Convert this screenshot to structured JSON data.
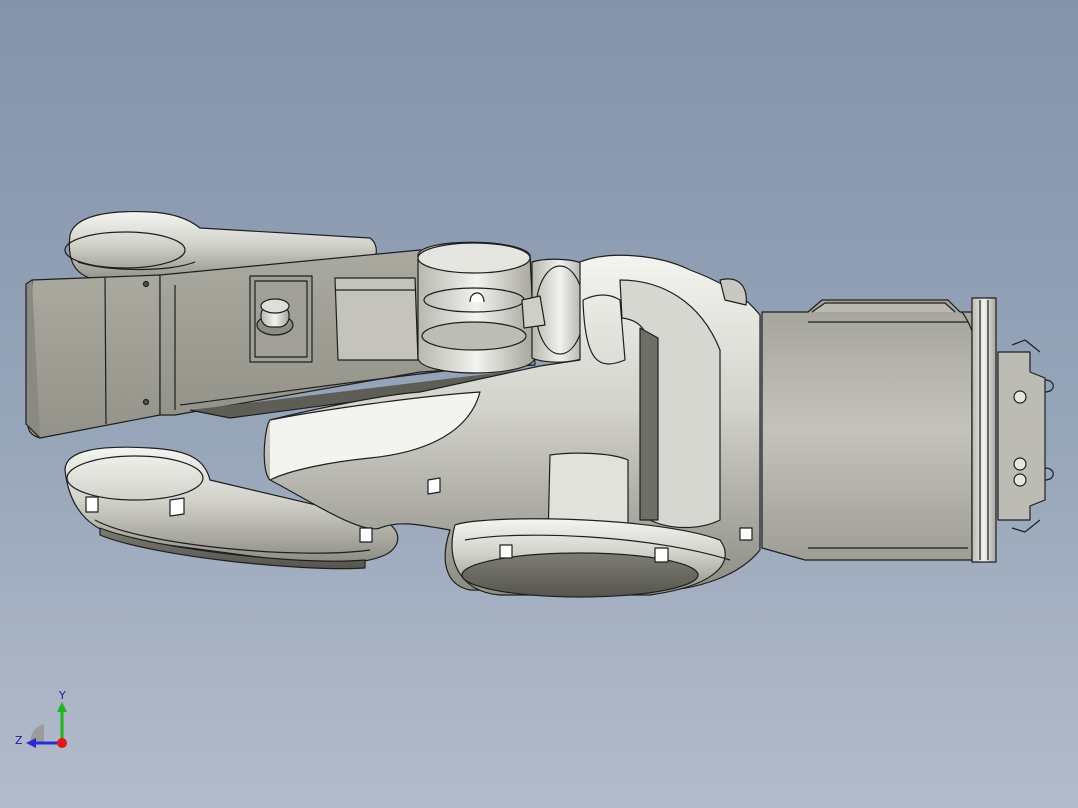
{
  "viewport": {
    "model": "robot-arm-assembly",
    "background_top": "#8393aa",
    "background_bottom": "#b4bccb",
    "part_color": "#d9d9d3",
    "edge_color": "#1e1e1e"
  },
  "triad": {
    "y_label": "Y",
    "z_label": "Z",
    "y_color": "#22b322",
    "z_color": "#2b2bd6",
    "x_color": "#e01818"
  }
}
